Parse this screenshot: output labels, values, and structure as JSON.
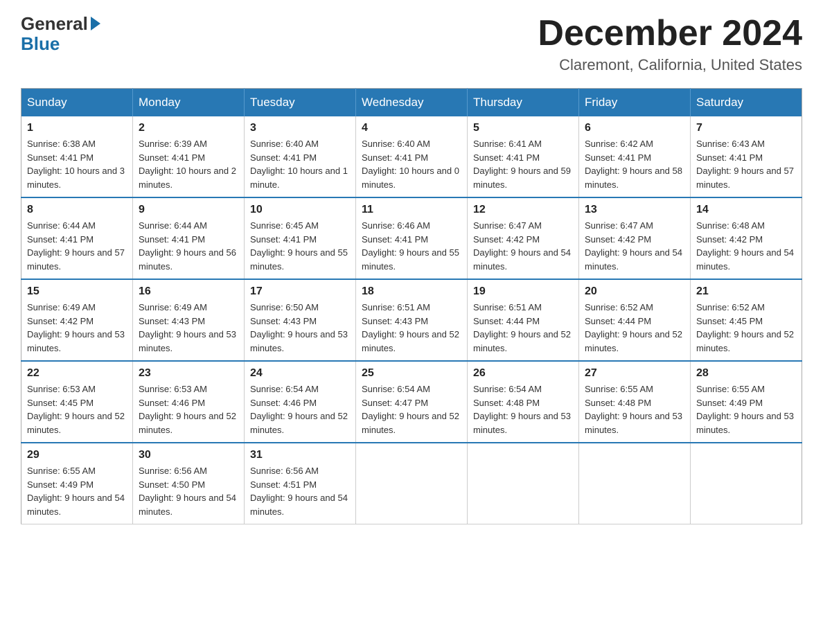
{
  "header": {
    "logo_general": "General",
    "logo_blue": "Blue",
    "month_title": "December 2024",
    "location": "Claremont, California, United States"
  },
  "weekdays": [
    "Sunday",
    "Monday",
    "Tuesday",
    "Wednesday",
    "Thursday",
    "Friday",
    "Saturday"
  ],
  "weeks": [
    [
      {
        "day": "1",
        "sunrise": "6:38 AM",
        "sunset": "4:41 PM",
        "daylight": "10 hours and 3 minutes."
      },
      {
        "day": "2",
        "sunrise": "6:39 AM",
        "sunset": "4:41 PM",
        "daylight": "10 hours and 2 minutes."
      },
      {
        "day": "3",
        "sunrise": "6:40 AM",
        "sunset": "4:41 PM",
        "daylight": "10 hours and 1 minute."
      },
      {
        "day": "4",
        "sunrise": "6:40 AM",
        "sunset": "4:41 PM",
        "daylight": "10 hours and 0 minutes."
      },
      {
        "day": "5",
        "sunrise": "6:41 AM",
        "sunset": "4:41 PM",
        "daylight": "9 hours and 59 minutes."
      },
      {
        "day": "6",
        "sunrise": "6:42 AM",
        "sunset": "4:41 PM",
        "daylight": "9 hours and 58 minutes."
      },
      {
        "day": "7",
        "sunrise": "6:43 AM",
        "sunset": "4:41 PM",
        "daylight": "9 hours and 57 minutes."
      }
    ],
    [
      {
        "day": "8",
        "sunrise": "6:44 AM",
        "sunset": "4:41 PM",
        "daylight": "9 hours and 57 minutes."
      },
      {
        "day": "9",
        "sunrise": "6:44 AM",
        "sunset": "4:41 PM",
        "daylight": "9 hours and 56 minutes."
      },
      {
        "day": "10",
        "sunrise": "6:45 AM",
        "sunset": "4:41 PM",
        "daylight": "9 hours and 55 minutes."
      },
      {
        "day": "11",
        "sunrise": "6:46 AM",
        "sunset": "4:41 PM",
        "daylight": "9 hours and 55 minutes."
      },
      {
        "day": "12",
        "sunrise": "6:47 AM",
        "sunset": "4:42 PM",
        "daylight": "9 hours and 54 minutes."
      },
      {
        "day": "13",
        "sunrise": "6:47 AM",
        "sunset": "4:42 PM",
        "daylight": "9 hours and 54 minutes."
      },
      {
        "day": "14",
        "sunrise": "6:48 AM",
        "sunset": "4:42 PM",
        "daylight": "9 hours and 54 minutes."
      }
    ],
    [
      {
        "day": "15",
        "sunrise": "6:49 AM",
        "sunset": "4:42 PM",
        "daylight": "9 hours and 53 minutes."
      },
      {
        "day": "16",
        "sunrise": "6:49 AM",
        "sunset": "4:43 PM",
        "daylight": "9 hours and 53 minutes."
      },
      {
        "day": "17",
        "sunrise": "6:50 AM",
        "sunset": "4:43 PM",
        "daylight": "9 hours and 53 minutes."
      },
      {
        "day": "18",
        "sunrise": "6:51 AM",
        "sunset": "4:43 PM",
        "daylight": "9 hours and 52 minutes."
      },
      {
        "day": "19",
        "sunrise": "6:51 AM",
        "sunset": "4:44 PM",
        "daylight": "9 hours and 52 minutes."
      },
      {
        "day": "20",
        "sunrise": "6:52 AM",
        "sunset": "4:44 PM",
        "daylight": "9 hours and 52 minutes."
      },
      {
        "day": "21",
        "sunrise": "6:52 AM",
        "sunset": "4:45 PM",
        "daylight": "9 hours and 52 minutes."
      }
    ],
    [
      {
        "day": "22",
        "sunrise": "6:53 AM",
        "sunset": "4:45 PM",
        "daylight": "9 hours and 52 minutes."
      },
      {
        "day": "23",
        "sunrise": "6:53 AM",
        "sunset": "4:46 PM",
        "daylight": "9 hours and 52 minutes."
      },
      {
        "day": "24",
        "sunrise": "6:54 AM",
        "sunset": "4:46 PM",
        "daylight": "9 hours and 52 minutes."
      },
      {
        "day": "25",
        "sunrise": "6:54 AM",
        "sunset": "4:47 PM",
        "daylight": "9 hours and 52 minutes."
      },
      {
        "day": "26",
        "sunrise": "6:54 AM",
        "sunset": "4:48 PM",
        "daylight": "9 hours and 53 minutes."
      },
      {
        "day": "27",
        "sunrise": "6:55 AM",
        "sunset": "4:48 PM",
        "daylight": "9 hours and 53 minutes."
      },
      {
        "day": "28",
        "sunrise": "6:55 AM",
        "sunset": "4:49 PM",
        "daylight": "9 hours and 53 minutes."
      }
    ],
    [
      {
        "day": "29",
        "sunrise": "6:55 AM",
        "sunset": "4:49 PM",
        "daylight": "9 hours and 54 minutes."
      },
      {
        "day": "30",
        "sunrise": "6:56 AM",
        "sunset": "4:50 PM",
        "daylight": "9 hours and 54 minutes."
      },
      {
        "day": "31",
        "sunrise": "6:56 AM",
        "sunset": "4:51 PM",
        "daylight": "9 hours and 54 minutes."
      },
      null,
      null,
      null,
      null
    ]
  ],
  "labels": {
    "sunrise": "Sunrise:",
    "sunset": "Sunset:",
    "daylight": "Daylight:"
  }
}
